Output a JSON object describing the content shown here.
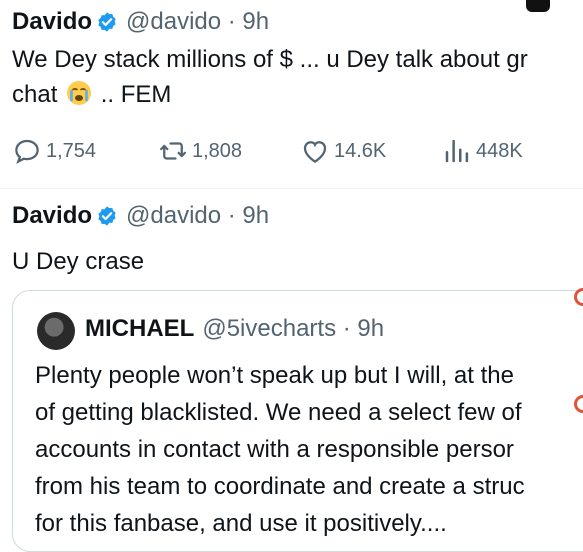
{
  "tweet1": {
    "name": "Davido",
    "handle_time": "@davido · 9h",
    "line1": "We Dey stack millions of $ ... u Dey talk about gr",
    "line2_before": "chat",
    "line2_after": ".. FEM",
    "emoji_icon": "crying-face-icon",
    "actions": {
      "replies": "1,754",
      "reposts": "1,808",
      "likes": "14.6K",
      "views": "448K"
    }
  },
  "tweet2": {
    "name": "Davido",
    "handle_time": "@davido · 9h",
    "text": "U Dey crase",
    "quote": {
      "name": "MICHAEL",
      "handle_time": "@5ivecharts · 9h",
      "lines": [
        "Plenty people won’t speak up but I will, at the",
        "of getting blacklisted. We need a select few of",
        "accounts in contact with a responsible persor",
        "from his team to coordinate and create a struc",
        "for this fanbase, and use it positively...."
      ]
    }
  },
  "colors": {
    "verified_blue": "#1d9bf0",
    "secondary_text": "#536471",
    "primary_text": "#0f1419",
    "border": "#cfd9de"
  }
}
